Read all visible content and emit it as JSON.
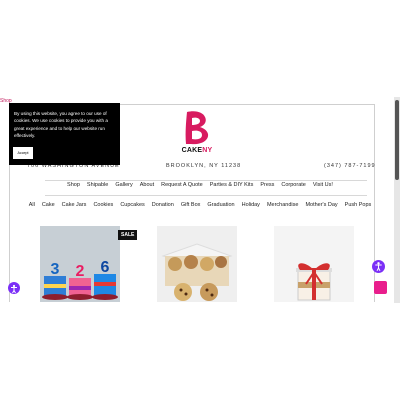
{
  "top_link": "Shop",
  "cookie_banner": {
    "text": "By using this website, you agree to our use of cookies. We use cookies to provide you with a great experience and to help our website run effectively.",
    "accept_label": "Accept"
  },
  "brand": {
    "logo_letter": "B",
    "name_part1": "CAKE",
    "name_part2": "NY"
  },
  "store_info": {
    "address": "706 WASHINGTON AVENUE",
    "city": "BROOKLYN, NY 11238",
    "phone": "(347) 787-7199"
  },
  "nav": [
    "Shop",
    "Shipable",
    "Gallery",
    "About",
    "Request A Quote",
    "Parties & DIY Kits",
    "Press",
    "Corporate",
    "Visit Us!"
  ],
  "categories": [
    "All",
    "Cake",
    "Cake Jars",
    "Cookies",
    "Cupcakes",
    "Donation",
    "Gift Box",
    "Graduation",
    "Holiday",
    "Merchandise",
    "Mother's Day",
    "Push Pops"
  ],
  "products": [
    {
      "badge": "SALE",
      "numbers": [
        "3",
        "2",
        "6"
      ]
    },
    {},
    {}
  ],
  "colors": {
    "brand_pink": "#d81b60",
    "accessibility": "#7b2ff7"
  }
}
